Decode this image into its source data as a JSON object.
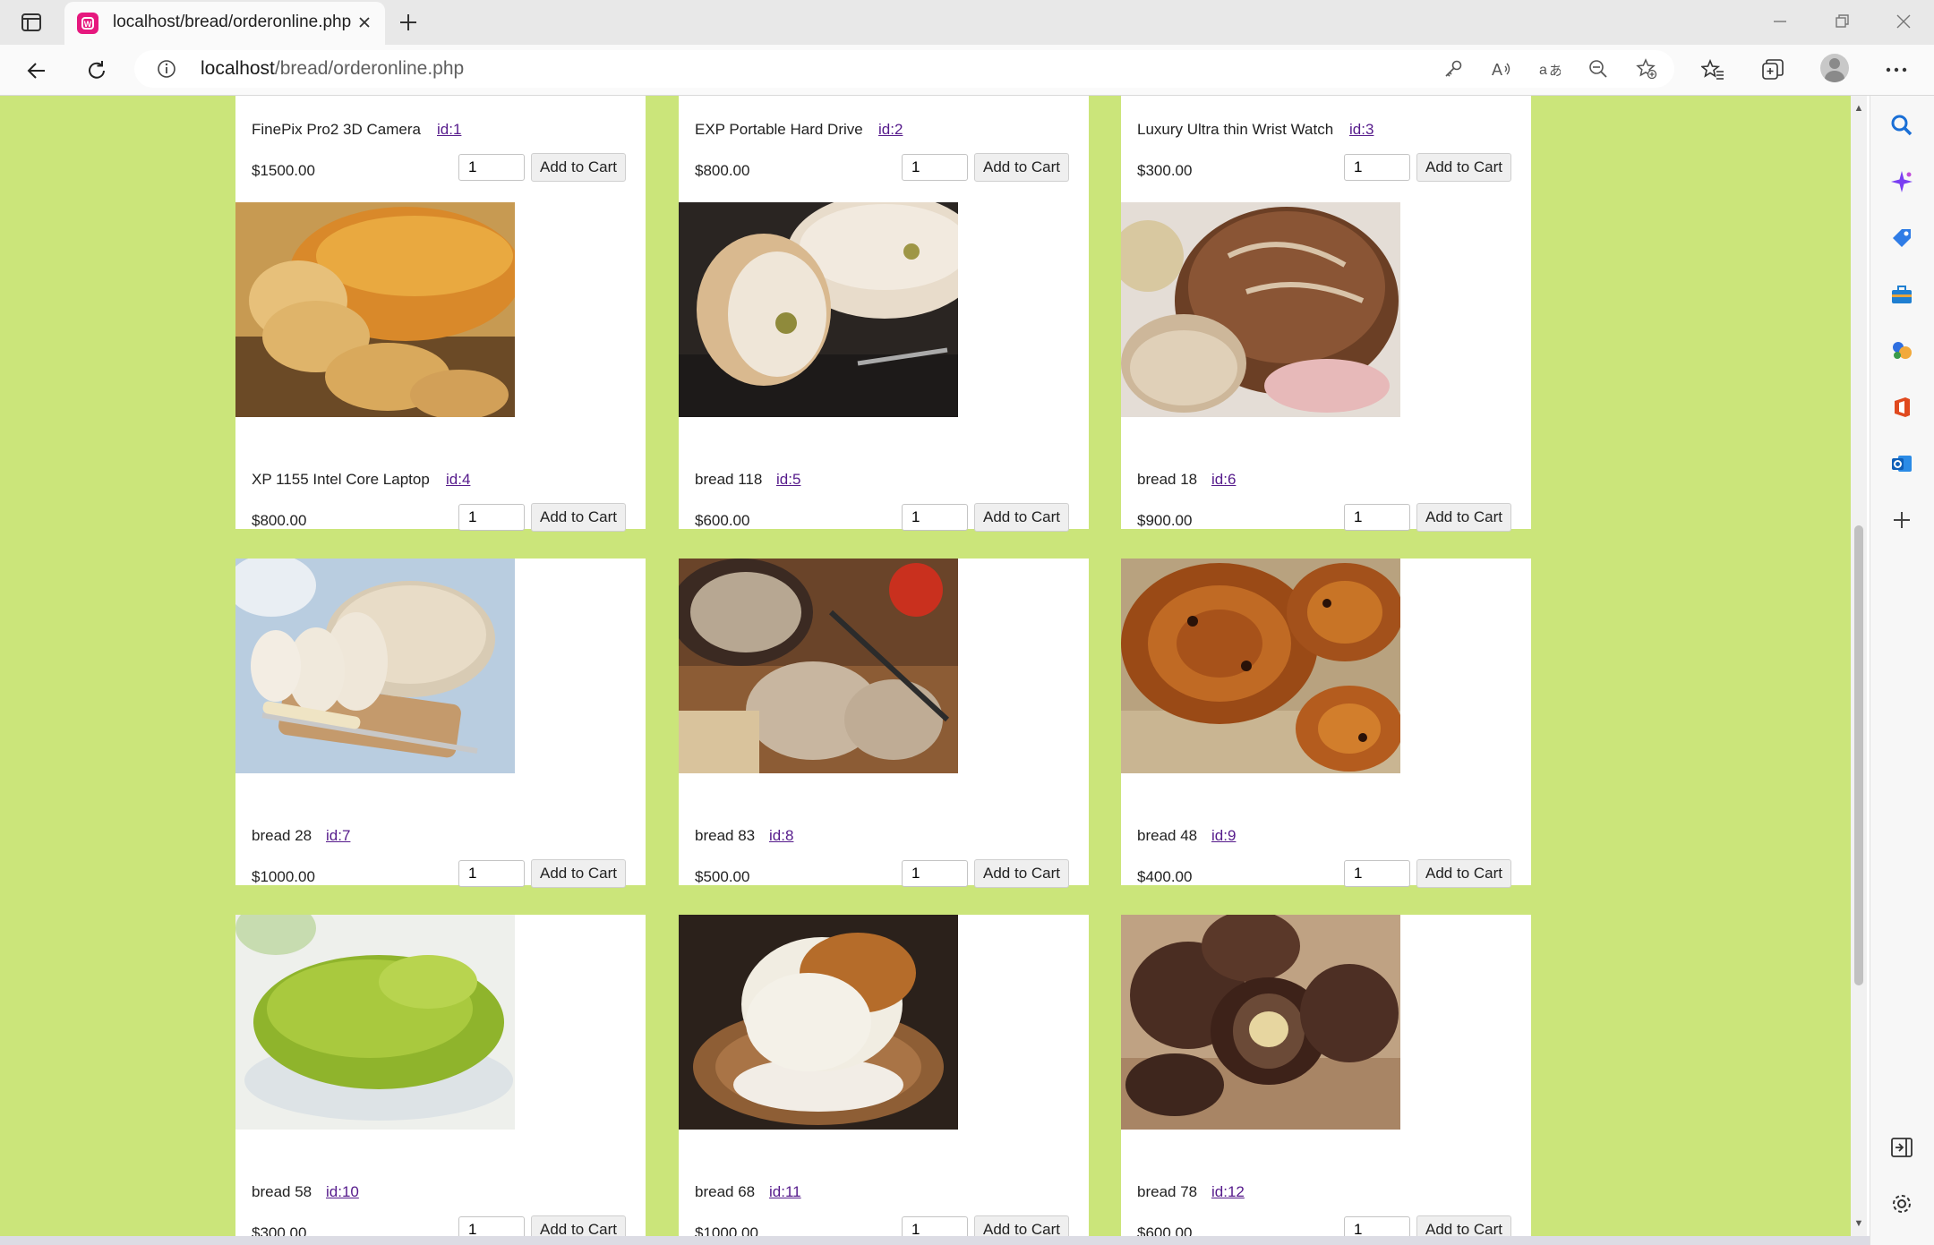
{
  "browser": {
    "tab_title": "localhost/bread/orderonline.php",
    "url_host": "localhost",
    "url_path": "/bread/orderonline.php"
  },
  "products": [
    {
      "name": "FinePix Pro2 3D Camera",
      "id_label": "id:1",
      "price": "$1500.00",
      "qty": "1",
      "button": "Add to Cart",
      "image": "camera-image"
    },
    {
      "name": "EXP Portable Hard Drive",
      "id_label": "id:2",
      "price": "$800.00",
      "qty": "1",
      "button": "Add to Cart",
      "image": "hard-drive-image"
    },
    {
      "name": "Luxury Ultra thin Wrist Watch",
      "id_label": "id:3",
      "price": "$300.00",
      "qty": "1",
      "button": "Add to Cart",
      "image": "watch-image"
    },
    {
      "name": "XP 1155 Intel Core Laptop",
      "id_label": "id:4",
      "price": "$800.00",
      "qty": "1",
      "button": "Add to Cart",
      "image": "sliced-loaf-image"
    },
    {
      "name": "bread 118",
      "id_label": "id:5",
      "price": "$600.00",
      "qty": "1",
      "button": "Add to Cart",
      "image": "olive-bread-image"
    },
    {
      "name": "bread 18",
      "id_label": "id:6",
      "price": "$900.00",
      "qty": "1",
      "button": "Add to Cart",
      "image": "sourdough-image"
    },
    {
      "name": "bread 28",
      "id_label": "id:7",
      "price": "$1000.00",
      "qty": "1",
      "button": "Add to Cart",
      "image": "white-loaf-image"
    },
    {
      "name": "bread 83",
      "id_label": "id:8",
      "price": "$500.00",
      "qty": "1",
      "button": "Add to Cart",
      "image": "rye-bread-image"
    },
    {
      "name": "bread 48",
      "id_label": "id:9",
      "price": "$400.00",
      "qty": "1",
      "button": "Add to Cart",
      "image": "raisin-swirl-image"
    },
    {
      "name": "bread 58",
      "id_label": "id:10",
      "price": "$300.00",
      "qty": "1",
      "button": "Add to Cart",
      "image": "green-bun-image"
    },
    {
      "name": "bread 68",
      "id_label": "id:11",
      "price": "$1000.00",
      "qty": "1",
      "button": "Add to Cart",
      "image": "cake-bread-image"
    },
    {
      "name": "bread 78",
      "id_label": "id:12",
      "price": "$600.00",
      "qty": "1",
      "button": "Add to Cart",
      "image": "brown-rolls-image"
    }
  ],
  "colors": {
    "page_background": "#cbe57a",
    "link": "#551a8b",
    "favicon": "#e6187e"
  }
}
